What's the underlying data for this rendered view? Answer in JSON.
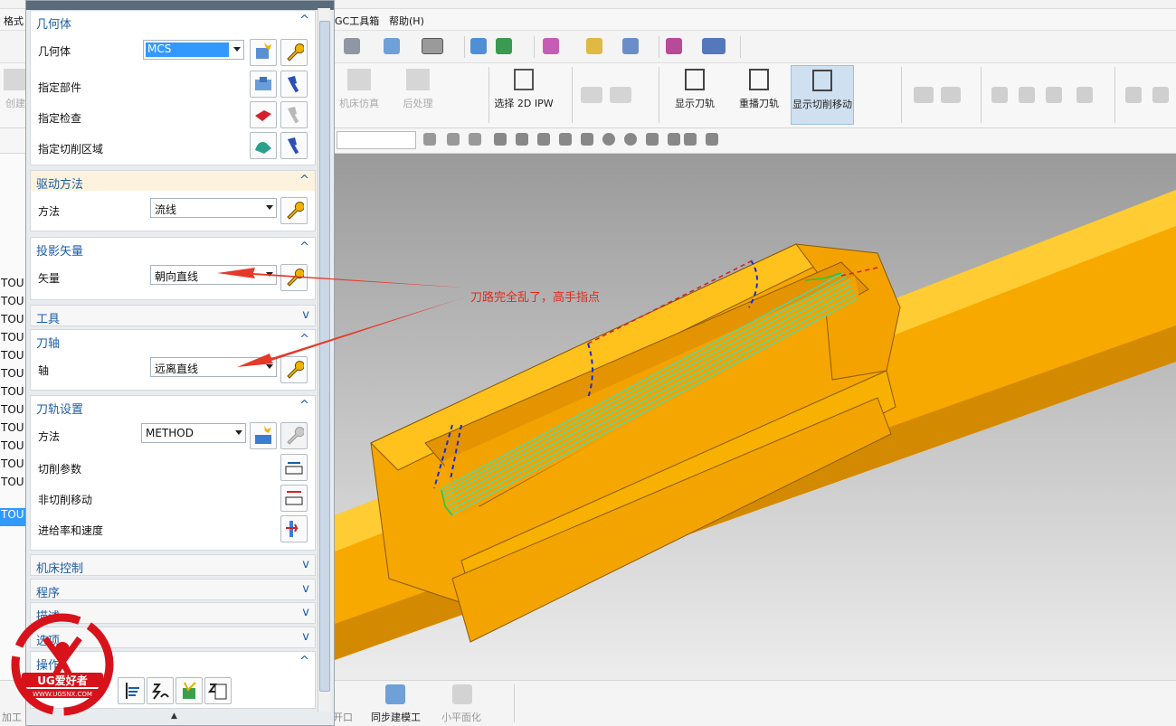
{
  "menubar": {
    "format": "格式",
    "gc_toolbox": "GC工具箱",
    "help": "帮助(H)"
  },
  "ribbon": {
    "create": "创建",
    "machine_sim": "机床仿真",
    "post_process": "后处理",
    "select_2d_ipw": "选择 2D IPW",
    "show_toolpath": "显示刀轨",
    "replay_toolpath": "重播刀轨",
    "show_cut_move": "显示切削移动"
  },
  "bottom": {
    "machining": "加工",
    "open": "开口",
    "sync_modeling": "同步建模工",
    "small_plane": "小平面化"
  },
  "navigator": {
    "rows": [
      "TOU",
      "TOU",
      "TOU",
      "TOU",
      "TOU",
      "TOU",
      "TOU",
      "TOU",
      "TOU",
      "TOU",
      "TOU",
      "TOU",
      "TOU"
    ]
  },
  "dialog": {
    "geometry": {
      "title": "几何体",
      "geometry_label": "几何体",
      "geometry_value": "MCS",
      "part_label": "指定部件",
      "check_label": "指定检查",
      "cut_area_label": "指定切削区域"
    },
    "drive": {
      "title": "驱动方法",
      "method_label": "方法",
      "method_value": "流线"
    },
    "projection": {
      "title": "投影矢量",
      "vector_label": "矢量",
      "vector_value": "朝向直线"
    },
    "tool": {
      "title": "工具"
    },
    "axis": {
      "title": "刀轴",
      "axis_label": "轴",
      "axis_value": "远离直线"
    },
    "path_settings": {
      "title": "刀轨设置",
      "method_label": "方法",
      "method_value": "METHOD",
      "cut_params": "切削参数",
      "non_cut": "非切削移动",
      "feeds": "进给率和速度"
    },
    "machine_ctrl": {
      "title": "机床控制"
    },
    "program": {
      "title": "程序"
    },
    "description": {
      "title": "描述"
    },
    "options": {
      "title": "选项"
    },
    "actions": {
      "title": "操作"
    }
  },
  "annotation": {
    "text": "刀路完全乱了，高手指点",
    "color": "#e02a1f"
  },
  "logo": {
    "brand": "UG爱好者",
    "url": "WWW.UGSNX.COM"
  },
  "colors": {
    "part": "#f5a800",
    "accent": "#1b5ea8",
    "toolpath": "#2fe6c8"
  }
}
